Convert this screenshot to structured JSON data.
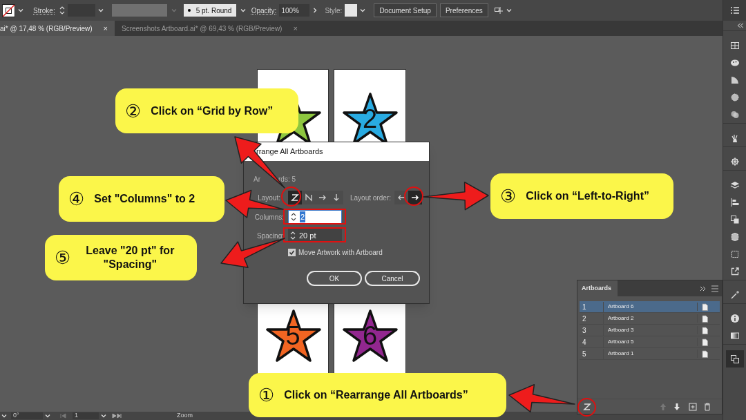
{
  "toolbar": {
    "stroke_label": "Stroke:",
    "brush": "5 pt. Round",
    "opacity_label": "Opacity:",
    "opacity": "100%",
    "style_label": "Style:",
    "buttons": [
      "Document Setup",
      "Preferences"
    ]
  },
  "tabs": [
    {
      "label": "ai* @ 17,48 % (RGB/Preview)",
      "close": "×",
      "selected": true
    },
    {
      "label": "Screenshots Artboard.ai* @ 69,43 % (RGB/Preview)",
      "close": "×",
      "selected": false
    }
  ],
  "artboards": [
    {
      "color": "#8dc63f"
    },
    {
      "color": "#29abe2",
      "number": "2"
    },
    {
      "color": "#f26522",
      "number": "5"
    },
    {
      "color": "#92278f",
      "number": "6"
    }
  ],
  "dialog": {
    "title": "rrange All Artboards",
    "count_start": "Ar",
    "count_end": "rds: 5",
    "layout_label": "Layout:",
    "layout_options": [
      {
        "kind": "gridrow",
        "selected": true
      },
      {
        "kind": "gridcol",
        "selected": false
      },
      {
        "kind": "row",
        "selected": false
      },
      {
        "kind": "column",
        "selected": false
      }
    ],
    "order_label": "Layout order:",
    "order_options": [
      {
        "kind": "left",
        "selected": false
      },
      {
        "kind": "right",
        "selected": true
      }
    ],
    "columns_label": "Columns:",
    "columns": "2",
    "spacing_label": "Spacing:",
    "spacing": "20 pt",
    "move_artwork": {
      "label": "Move Artwork with Artboard",
      "checked": true
    },
    "buttons": [
      "OK",
      "Cancel"
    ]
  },
  "artboards_panel": {
    "title": "Artboards",
    "rows": [
      {
        "index": "1",
        "name": "Artboard 6",
        "selected": true
      },
      {
        "index": "2",
        "name": "Artboard 2",
        "selected": false
      },
      {
        "index": "3",
        "name": "Artboard 3",
        "selected": false
      },
      {
        "index": "4",
        "name": "Artboard 5",
        "selected": false
      },
      {
        "index": "5",
        "name": "Artboard 1",
        "selected": false
      }
    ]
  },
  "status_bar": {
    "angle": "0°",
    "page": "1",
    "zoom": "Zoom"
  },
  "callouts": [
    {
      "step": "②",
      "text": "Click on “Grid by Row”"
    },
    {
      "step": "④",
      "text": "Set \"Columns\" to 2"
    },
    {
      "step": "⑤",
      "text": "Leave \"20 pt\" for \"Spacing\""
    },
    {
      "step": "③",
      "text": "Click on “Left-to-Right”"
    },
    {
      "step": "①",
      "text": "Click on “Rearrange All Artboards”"
    }
  ]
}
